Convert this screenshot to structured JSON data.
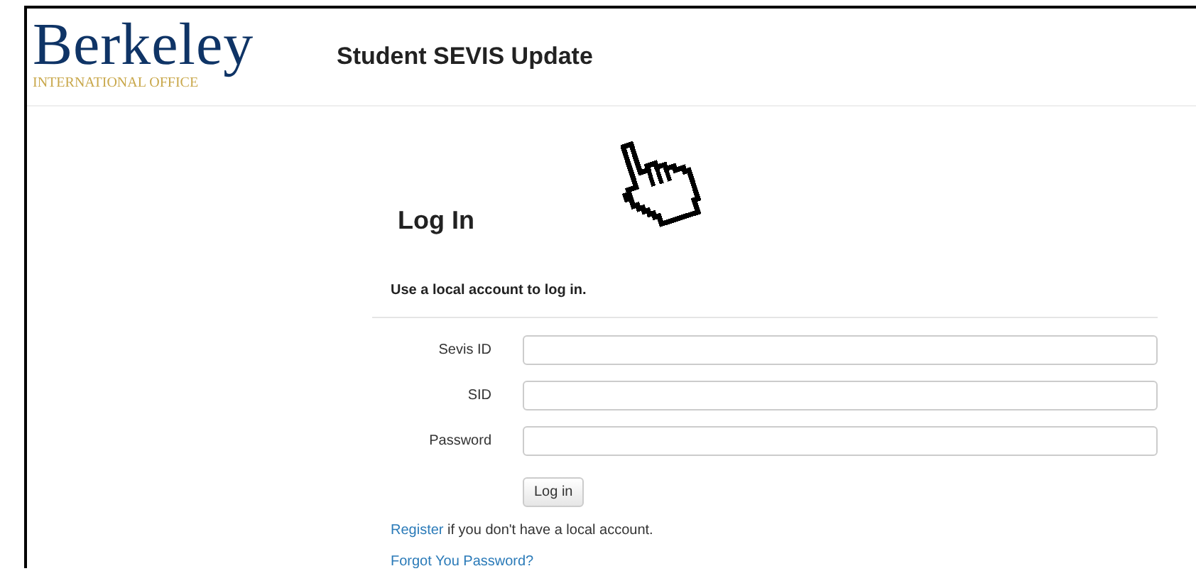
{
  "logo": {
    "name": "Berkeley",
    "subtitle": "INTERNATIONAL OFFICE"
  },
  "header": {
    "title": "Student SEVIS Update"
  },
  "login": {
    "heading": "Log In",
    "subheading": "Use a local account to log in.",
    "fields": [
      {
        "label": "Sevis ID"
      },
      {
        "label": "SID"
      },
      {
        "label": "Password"
      }
    ],
    "button": "Log in",
    "register": {
      "link": "Register",
      "text": " if you don't have a local account."
    },
    "forgot": "Forgot You Password?"
  }
}
